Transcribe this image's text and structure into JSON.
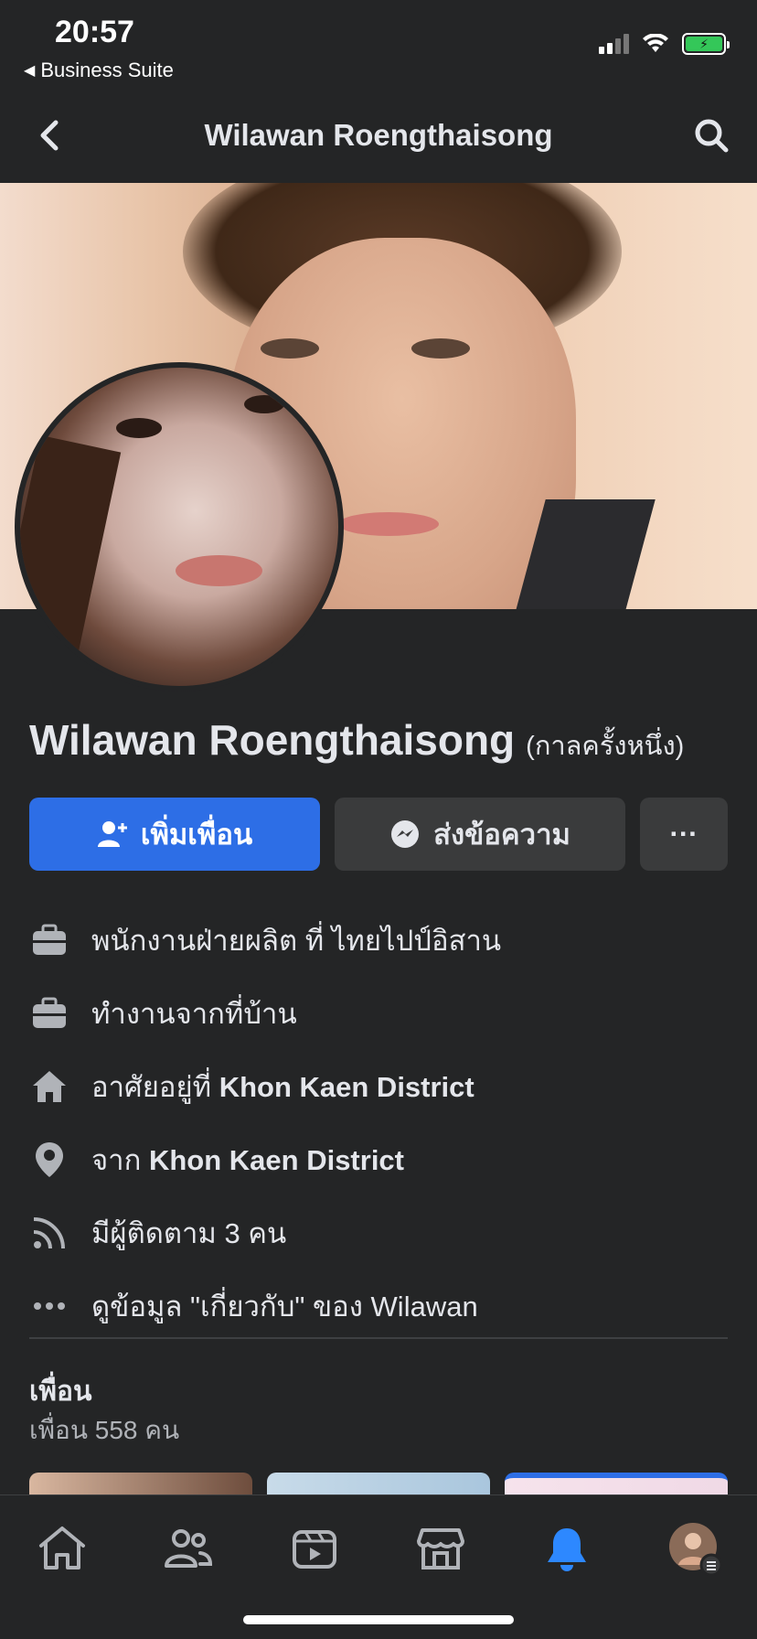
{
  "status_bar": {
    "time": "20:57",
    "back_app_label": "Business Suite",
    "icons": [
      "cellular-signal-icon",
      "wifi-icon",
      "battery-charging-icon"
    ]
  },
  "header": {
    "title": "Wilawan Roengthaisong",
    "back_icon": "chevron-left-icon",
    "search_icon": "search-icon"
  },
  "profile": {
    "name": "Wilawan Roengthaisong",
    "alternate_name": "(กาลครั้งหนึ่ง)"
  },
  "actions": {
    "add_friend_label": "เพิ่มเพื่อน",
    "message_label": "ส่งข้อความ",
    "more_label": "···"
  },
  "info": [
    {
      "icon": "briefcase-icon",
      "text": "พนักงานฝ่ายผลิต ที่ ไทยไปป์อิสาน",
      "bold": ""
    },
    {
      "icon": "briefcase-icon",
      "text": "ทำงานจากที่บ้าน",
      "bold": ""
    },
    {
      "icon": "home-icon",
      "text": "อาศัยอยู่ที่ ",
      "bold": "Khon Kaen District"
    },
    {
      "icon": "location-pin-icon",
      "text": "จาก ",
      "bold": "Khon Kaen District"
    },
    {
      "icon": "rss-feed-icon",
      "text": "มีผู้ติดตาม 3 คน",
      "bold": ""
    },
    {
      "icon": "more-dots-icon",
      "text": "ดูข้อมูล \"เกี่ยวกับ\" ของ Wilawan",
      "bold": ""
    }
  ],
  "friends": {
    "title": "เพื่อน",
    "count_text": "เพื่อน 558 คน"
  },
  "tabbar": {
    "tabs": [
      "home-icon",
      "friends-icon",
      "watch-icon",
      "marketplace-icon",
      "notifications-icon",
      "profile-menu-icon"
    ],
    "active_color": "#2d88ff"
  },
  "colors": {
    "background": "#242526",
    "primary_button": "#2d6ee6",
    "secondary_button": "#3a3b3c",
    "text": "#e4e6eb",
    "muted_text": "#b0b3b8"
  }
}
